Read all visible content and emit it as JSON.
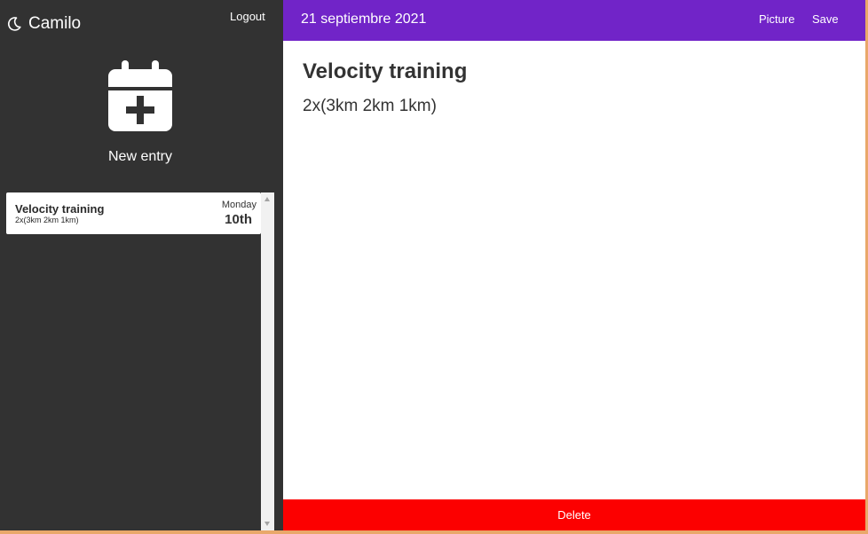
{
  "sidebar": {
    "username": "Camilo",
    "logout_label": "Logout",
    "new_entry_label": "New entry",
    "entries": [
      {
        "title": "Velocity training",
        "subtitle": "2x(3km 2km 1km)",
        "weekday": "Monday",
        "date": "10th"
      }
    ]
  },
  "header": {
    "date_title": "21 septiembre 2021",
    "picture_label": "Picture",
    "save_label": "Save"
  },
  "main": {
    "title": "Velocity training",
    "body": "2x(3km 2km 1km)",
    "delete_label": "Delete"
  },
  "icons": {
    "theme": "moon-icon",
    "new_entry": "calendar-plus-icon"
  },
  "colors": {
    "sidebar_bg": "#323232",
    "header_bg": "#7124c8",
    "delete_bg": "#fc0000",
    "outer_border": "#e9a86a"
  }
}
